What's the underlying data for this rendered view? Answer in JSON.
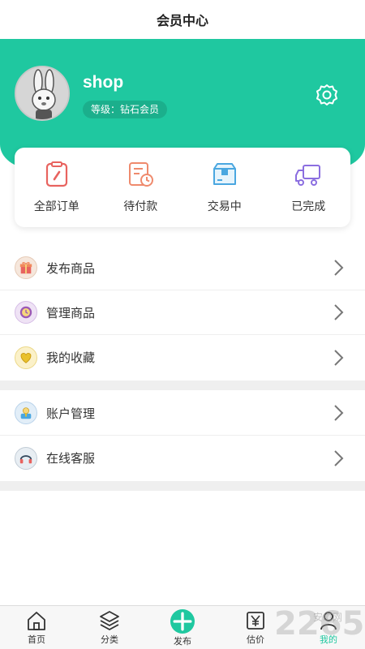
{
  "topbar": {
    "title": "会员中心"
  },
  "profile": {
    "username": "shop",
    "level_label": "等级：",
    "level_value": "钻石会员",
    "avatar_icon": "rabbit-avatar-icon",
    "settings_icon": "gear-icon"
  },
  "orders": [
    {
      "label": "全部订单",
      "icon": "order-clipboard-icon",
      "color": "#e8635f"
    },
    {
      "label": "待付款",
      "icon": "pending-payment-icon",
      "color": "#ef8a6d"
    },
    {
      "label": "交易中",
      "icon": "package-box-icon",
      "color": "#4aa7e0"
    },
    {
      "label": "已完成",
      "icon": "delivery-truck-icon",
      "color": "#8b6ee0"
    }
  ],
  "menu_group_1": [
    {
      "label": "发布商品",
      "icon": "gift-icon"
    },
    {
      "label": "管理商品",
      "icon": "clock-icon"
    },
    {
      "label": "我的收藏",
      "icon": "heart-icon"
    }
  ],
  "menu_group_2": [
    {
      "label": "账户管理",
      "icon": "account-icon"
    },
    {
      "label": "在线客服",
      "icon": "headset-icon"
    }
  ],
  "tabbar": [
    {
      "label": "首页",
      "icon": "home-icon"
    },
    {
      "label": "分类",
      "icon": "layers-icon"
    },
    {
      "label": "发布",
      "icon": "plus-icon"
    },
    {
      "label": "估价",
      "icon": "yen-icon"
    },
    {
      "label": "我的",
      "icon": "user-icon",
      "active": true
    }
  ],
  "watermark": {
    "main": "2265",
    "sub": "安卓网"
  },
  "colors": {
    "accent": "#1fc8a0",
    "separator": "#efefef"
  }
}
